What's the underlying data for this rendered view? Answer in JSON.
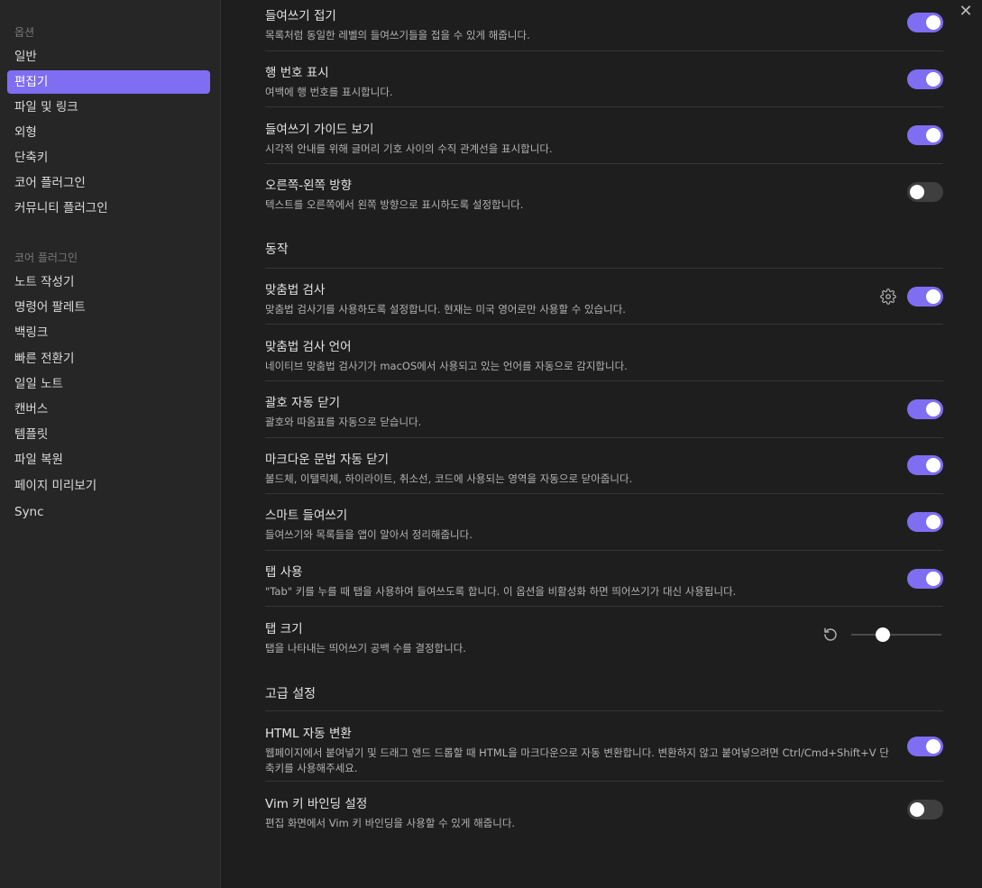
{
  "sidebar": {
    "options_header": "옵션",
    "options": [
      "일반",
      "편집기",
      "파일 및 링크",
      "외형",
      "단축키",
      "코어 플러그인",
      "커뮤니티 플러그인"
    ],
    "core_header": "코어 플러그인",
    "core": [
      "노트 작성기",
      "명령어 팔레트",
      "백링크",
      "빠른 전환기",
      "일일 노트",
      "캔버스",
      "템플릿",
      "파일 복원",
      "페이지 미리보기",
      "Sync"
    ]
  },
  "close_label": "✕",
  "sections": {
    "behavior": "동작",
    "advanced": "고급 설정"
  },
  "settings": [
    {
      "name": "들여쓰기 접기",
      "desc": "목록처럼 동일한 레벨의 들여쓰기들을 접을 수 있게 해줍니다.",
      "toggle": true
    },
    {
      "name": "행 번호 표시",
      "desc": "여백에 행 번호를 표시합니다.",
      "toggle": true
    },
    {
      "name": "들여쓰기 가이드 보기",
      "desc": "시각적 안내를 위해 글머리 기호 사이의 수직 관계선을 표시합니다.",
      "toggle": true
    },
    {
      "name": "오른쪽-왼쪽 방향",
      "desc": "텍스트를 오른쪽에서 왼쪽 방향으로 표시하도록 설정합니다.",
      "toggle": false
    },
    {
      "name": "맞춤법 검사",
      "desc": "맞춤법 검사기를 사용하도록 설정합니다. 현재는 미국 영어로만 사용할 수 있습니다.",
      "toggle": true
    },
    {
      "name": "맞춤법 검사 언어",
      "desc": "네이티브 맞춤법 검사기가 macOS에서 사용되고 있는 언어를 자동으로 감지합니다."
    },
    {
      "name": "괄호 자동 닫기",
      "desc": "괄호와 따옴표를 자동으로 닫습니다.",
      "toggle": true
    },
    {
      "name": "마크다운 문법 자동 닫기",
      "desc": "볼드체, 이탤릭체, 하이라이트, 취소선, 코드에 사용되는 영역을 자동으로 닫아줍니다.",
      "toggle": true
    },
    {
      "name": "스마트 들여쓰기",
      "desc": "들여쓰기와 목록들을 앱이 알아서 정리해줍니다.",
      "toggle": true
    },
    {
      "name": "탭 사용",
      "desc": "\"Tab\" 키를 누를 때 탭을 사용하여 들여쓰도록 합니다. 이 옵션을 비활성화 하면 띄어쓰기가 대신 사용됩니다.",
      "toggle": true
    },
    {
      "name": "탭 크기",
      "desc": "탭을 나타내는 띄어쓰기 공백 수를 결정합니다.",
      "slider_fraction": 0.35
    },
    {
      "name": "HTML 자동 변환",
      "desc": "웹페이지에서 붙여넣기 및 드래그 앤드 드롭할 때 HTML을 마크다운으로 자동 변환합니다. 변환하지 않고 붙여넣으려면 Ctrl/Cmd+Shift+V 단축키를 사용해주세요.",
      "toggle": true
    },
    {
      "name": "Vim 키 바인딩 설정",
      "desc": "편집 화면에서 Vim 키 바인딩을 사용할 수 있게 해줍니다.",
      "toggle": false
    }
  ],
  "icons": {
    "close": "close-icon",
    "gear": "gear-icon",
    "reset": "reset-icon"
  },
  "colors": {
    "accent": "#7f6df2",
    "background": "#1e1e1e",
    "sidebar": "#262626"
  }
}
